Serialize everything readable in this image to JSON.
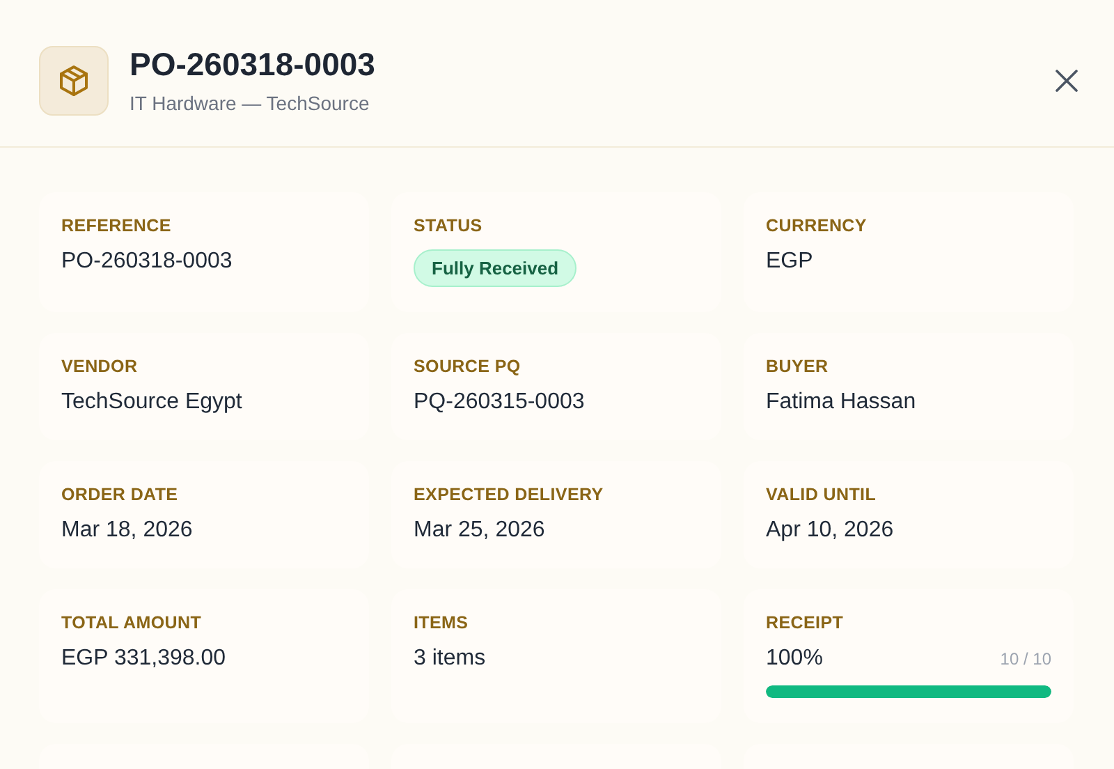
{
  "header": {
    "title": "PO-260318-0003",
    "subtitle": "IT Hardware — TechSource"
  },
  "fields": [
    {
      "kind": "text",
      "label": "REFERENCE",
      "value": "PO-260318-0003"
    },
    {
      "kind": "badge",
      "label": "STATUS",
      "value": "Fully Received",
      "color": "#d1fae5"
    },
    {
      "kind": "text",
      "label": "CURRENCY",
      "value": "EGP"
    },
    {
      "kind": "text",
      "label": "VENDOR",
      "value": "TechSource Egypt"
    },
    {
      "kind": "text",
      "label": "SOURCE PQ",
      "value": "PQ-260315-0003"
    },
    {
      "kind": "text",
      "label": "BUYER",
      "value": "Fatima Hassan"
    },
    {
      "kind": "text",
      "label": "ORDER DATE",
      "value": "Mar 18, 2026"
    },
    {
      "kind": "text",
      "label": "EXPECTED DELIVERY",
      "value": "Mar 25, 2026"
    },
    {
      "kind": "text",
      "label": "VALID UNTIL",
      "value": "Apr 10, 2026"
    },
    {
      "kind": "text",
      "label": "TOTAL AMOUNT",
      "value": "EGP 331,398.00"
    },
    {
      "kind": "text",
      "label": "ITEMS",
      "value": "3 items"
    },
    {
      "kind": "progress",
      "label": "RECEIPT",
      "value": "100%",
      "count": "10 / 10",
      "level": 1
    }
  ]
}
